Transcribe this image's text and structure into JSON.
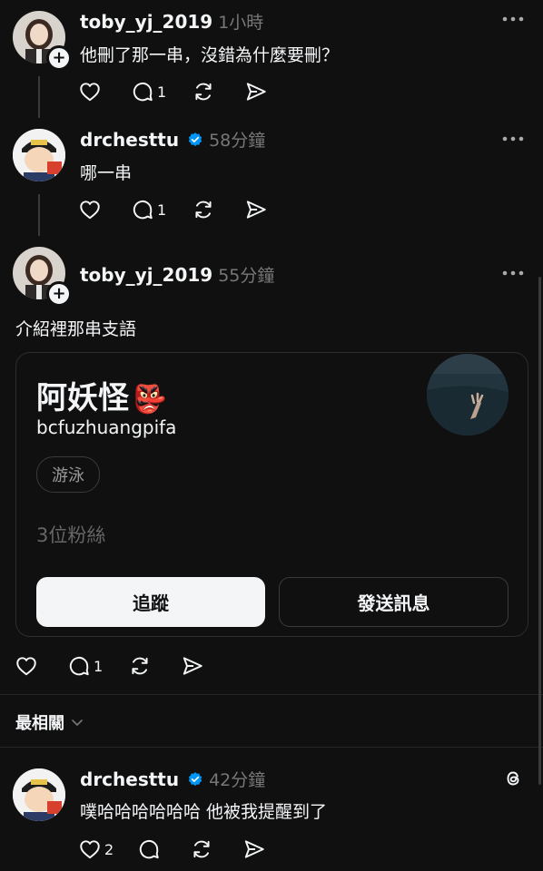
{
  "posts": [
    {
      "username": "toby_yj_2019",
      "time": "1小時",
      "text": "他刪了那一串，沒錯為什麼要刪？",
      "replies": "1"
    },
    {
      "username": "drchesttu",
      "time": "58分鐘",
      "text": "哪一串",
      "replies": "1"
    },
    {
      "username": "toby_yj_2019",
      "time": "55分鐘",
      "text": "介紹裡那串支語",
      "replies": "1"
    }
  ],
  "profile_card": {
    "name": "阿妖怪",
    "emoji": "👺",
    "handle": "bcfuzhuangpifa",
    "tag": "游泳",
    "followers": "3位粉絲",
    "follow_label": "追蹤",
    "message_label": "發送訊息"
  },
  "sort": {
    "label": "最相關"
  },
  "reply": {
    "username": "drchesttu",
    "time": "42分鐘",
    "text": "噗哈哈哈哈哈哈 他被我提醒到了",
    "likes": "2"
  },
  "colors": {
    "background": "#101010",
    "verified": "#0095f6",
    "muted": "#777777"
  },
  "icons": [
    "heart-icon",
    "comment-icon",
    "repost-icon",
    "share-icon",
    "more-icon",
    "verified-icon",
    "threads-icon",
    "chevron-down-icon"
  ]
}
